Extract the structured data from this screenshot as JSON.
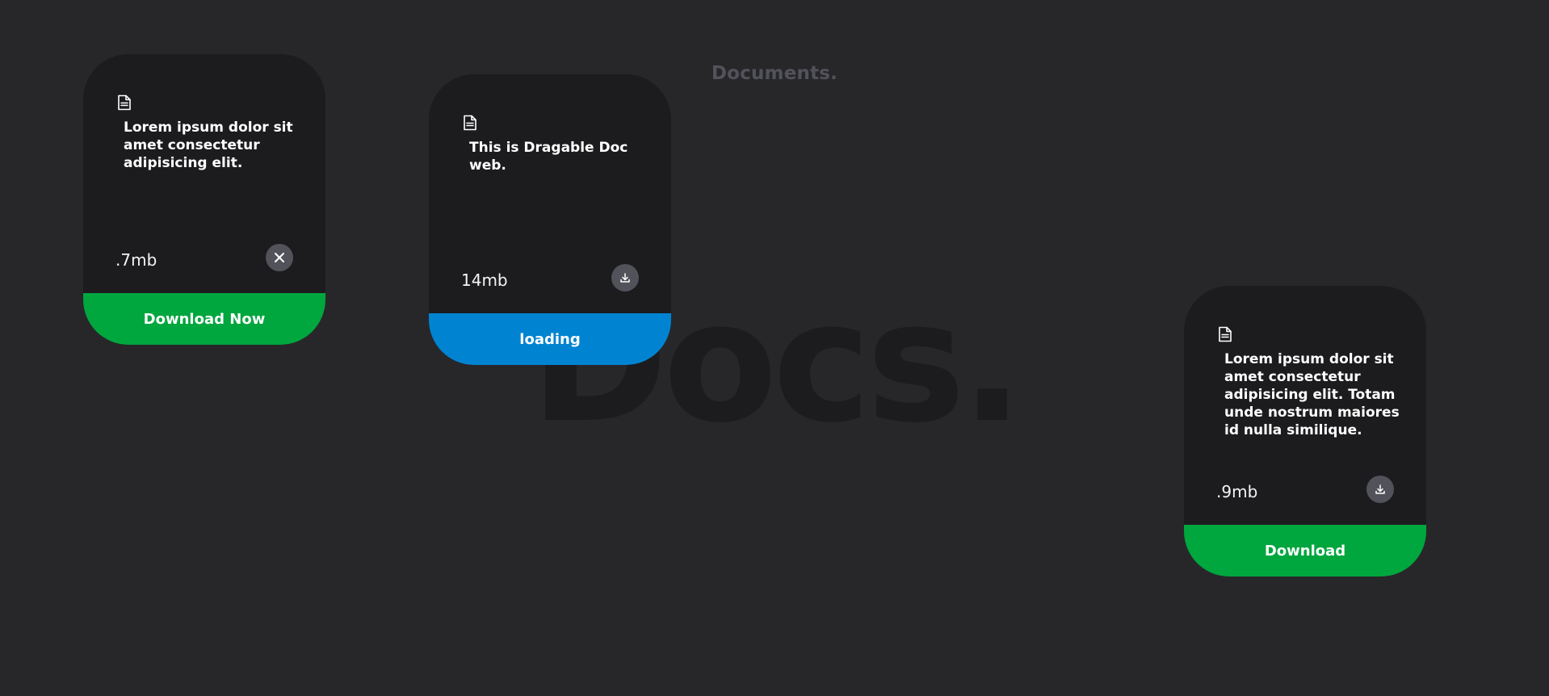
{
  "page": {
    "subtitle": "Documents.",
    "watermark": "Docs."
  },
  "colors": {
    "background": "#27272a",
    "card": "#1c1c1f",
    "download_green": "#00a63e",
    "loading_blue": "#0084d1",
    "icon_button": "#52525b"
  },
  "cards": [
    {
      "icon": "document-icon",
      "description": "Lorem ipsum dolor sit amet consectetur adipisicing elit.",
      "size": ".7mb",
      "action_icon": "close-icon",
      "footer_label": "Download Now",
      "footer_color": "green"
    },
    {
      "icon": "document-icon",
      "description": "This is Dragable Doc web.",
      "size": "14mb",
      "action_icon": "download-icon",
      "footer_label": "loading",
      "footer_color": "blue"
    },
    {
      "icon": "document-icon",
      "description": "Lorem ipsum dolor sit amet consectetur adipisicing elit. Totam unde nostrum maiores id nulla similique.",
      "size": ".9mb",
      "action_icon": "download-icon",
      "footer_label": "Download",
      "footer_color": "green"
    }
  ]
}
